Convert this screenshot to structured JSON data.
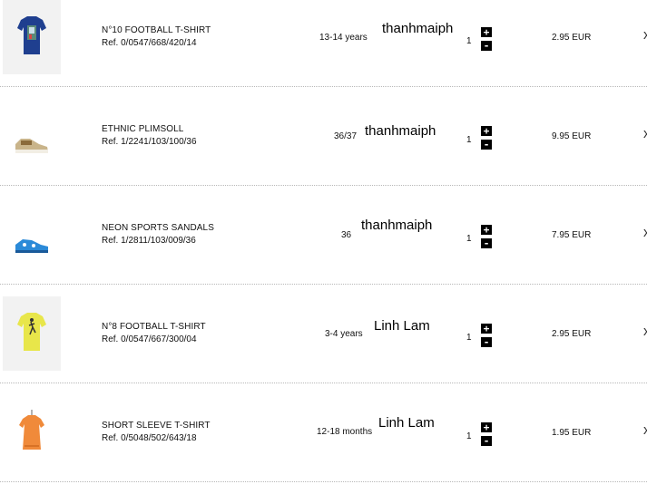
{
  "cart": {
    "items": [
      {
        "name": "N°10 FOOTBALL T-SHIRT",
        "ref": "Ref. 0/0547/668/420/14",
        "size": "13-14 years",
        "person": "thanhmaiph",
        "qty": "1",
        "price": "2.95 EUR",
        "plus": "+",
        "minus": "-",
        "remove": "x",
        "image_icon": "blue-tshirt-image"
      },
      {
        "name": "ETHNIC PLIMSOLL",
        "ref": "Ref. 1/2241/103/100/36",
        "size": "36/37",
        "person": "thanhmaiph",
        "qty": "1",
        "price": "9.95 EUR",
        "plus": "+",
        "minus": "-",
        "remove": "x",
        "image_icon": "plimsoll-shoe-image"
      },
      {
        "name": "NEON SPORTS SANDALS",
        "ref": "Ref. 1/2811/103/009/36",
        "size": "36",
        "person": "thanhmaiph",
        "qty": "1",
        "price": "7.95 EUR",
        "plus": "+",
        "minus": "-",
        "remove": "x",
        "image_icon": "blue-sandal-image"
      },
      {
        "name": "N°8 FOOTBALL T-SHIRT",
        "ref": "Ref. 0/0547/667/300/04",
        "size": "3-4 years",
        "person": "Linh Lam",
        "qty": "1",
        "price": "2.95 EUR",
        "plus": "+",
        "minus": "-",
        "remove": "x",
        "image_icon": "yellow-tshirt-image"
      },
      {
        "name": "SHORT SLEEVE T-SHIRT",
        "ref": "Ref. 0/5048/502/643/18",
        "size": "12-18 months",
        "person": "Linh Lam",
        "qty": "1",
        "price": "1.95 EUR",
        "plus": "+",
        "minus": "-",
        "remove": "x",
        "image_icon": "orange-tshirt-image"
      }
    ]
  },
  "colors": {
    "divider": "#b8b8b8",
    "thumb_bg": "#f2f2f2",
    "button_bg": "#000000"
  }
}
